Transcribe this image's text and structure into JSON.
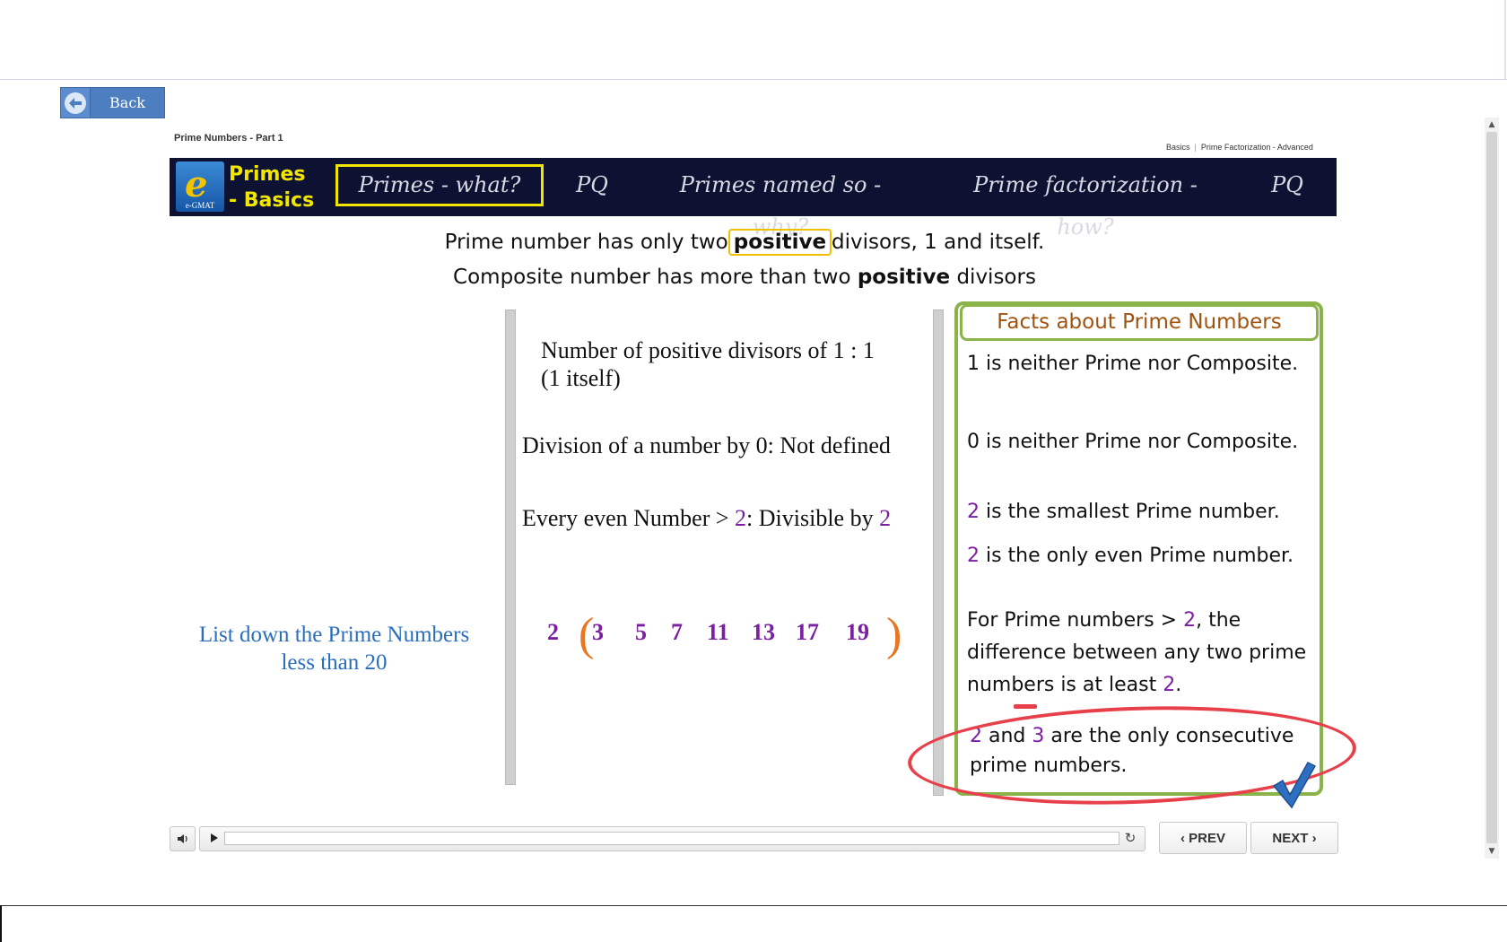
{
  "back": {
    "label": "Back"
  },
  "course": {
    "title": "Prime Numbers - Part 1"
  },
  "breadcrumb": {
    "item1": "Basics",
    "separator": "|",
    "item2": "Prime Factorization - Advanced"
  },
  "logo": {
    "letter": "e",
    "brand": "e-GMAT",
    "title_line1": "Primes",
    "title_line2": "- Basics"
  },
  "nav": {
    "items": [
      {
        "label": "Primes - what?",
        "active": true
      },
      {
        "label": "PQ"
      },
      {
        "label": "Primes named so - why?"
      },
      {
        "label": "Prime factorization - how?"
      },
      {
        "label": "PQ"
      }
    ]
  },
  "intro": {
    "line1_pre": "Prime number has only two",
    "line1_highlight": "positive",
    "line1_post": "divisors, 1 and itself.",
    "line2_pre": "Composite number has more than two ",
    "line2_bold": "positive",
    "line2_post": " divisors"
  },
  "middle": {
    "divisors_of_one_line1": "Number of positive divisors of 1 : 1",
    "divisors_of_one_line2": "(1 itself)",
    "division_by_zero": "Division of a number by 0:  Not defined",
    "even_pre": "Every even Number > ",
    "even_num": "2",
    "even_mid": ": Divisible by ",
    "even_num2": "2",
    "primes": [
      "2",
      "3",
      "5",
      "7",
      "11",
      "13",
      "17",
      "19"
    ],
    "bracket_open": "(",
    "bracket_close": ")"
  },
  "prompt": {
    "line1": "List down the Prime Numbers",
    "line2": "less than 20"
  },
  "facts": {
    "header": "Facts about Prime Numbers",
    "f1": "1 is neither Prime nor Composite.",
    "f2": "0 is neither Prime nor Composite.",
    "f3_num": "2",
    "f3_text": " is the smallest Prime number.",
    "f4_num": "2",
    "f4_text": " is the only even Prime number.",
    "f5_pre": "For Prime numbers > ",
    "f5_num": "2",
    "f5_mid": ", the difference between any two prime numbers is at least ",
    "f5_num2": "2",
    "f5_end": ".",
    "f6_num1": "2",
    "f6_and": " and ",
    "f6_num2": "3",
    "f6_text": " are the only consecutive prime numbers."
  },
  "controls": {
    "mute_icon": "speaker-icon",
    "play_icon": "play-icon",
    "replay_icon": "replay-icon",
    "prev_label": "‹ PREV",
    "next_label": "NEXT ›"
  },
  "colors": {
    "nav_bg": "#0d1233",
    "accent_yellow": "#f2e600",
    "purple": "#7b1fa2",
    "facts_green": "#8ab34a",
    "annotation_red": "#e8404a",
    "link_blue": "#2a6ebb"
  }
}
